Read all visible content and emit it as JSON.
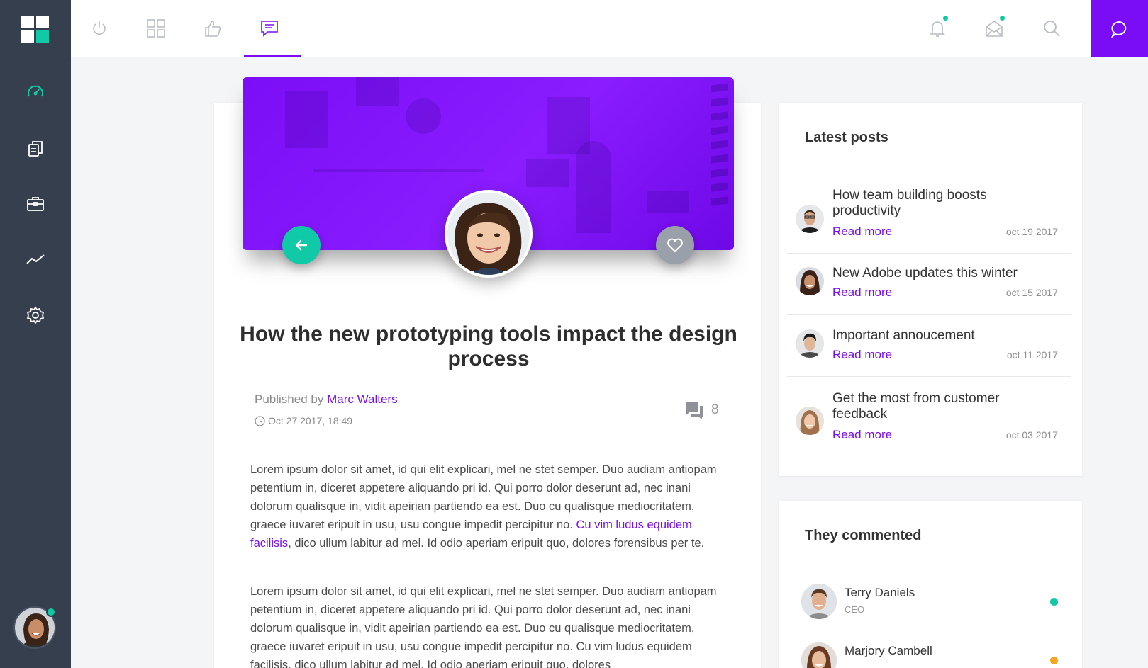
{
  "colors": {
    "accent": "#7a0df5",
    "teal": "#10c9a6",
    "sidebar_bg": "#363f4e",
    "online": "#10c9a6",
    "away": "#f5a623"
  },
  "sidebar": {
    "items": [
      {
        "icon": "speedometer-icon"
      },
      {
        "icon": "documents-icon"
      },
      {
        "icon": "briefcase-icon"
      },
      {
        "icon": "trend-chart-icon"
      },
      {
        "icon": "gear-icon"
      }
    ]
  },
  "topbar": {
    "tabs": [
      {
        "icon": "power-icon"
      },
      {
        "icon": "grid-icon"
      },
      {
        "icon": "thumbs-up-icon"
      },
      {
        "icon": "message-icon",
        "active": true
      }
    ],
    "actions": [
      {
        "icon": "bell-icon",
        "has_notification": true
      },
      {
        "icon": "mail-open-icon",
        "has_notification": true
      },
      {
        "icon": "search-icon"
      }
    ],
    "chat_icon": "chat-bubble-icon"
  },
  "article": {
    "title": "How the new prototyping tools impact the design process",
    "published_by_label": "Published by",
    "author": "Marc Walters",
    "date": "Oct 27 2017, 18:49",
    "comment_count": "8",
    "para1_before": "Lorem ipsum dolor sit amet, id qui elit explicari, mel ne stet semper. Duo audiam antiopam petentium in, diceret appetere aliquando pri id. Qui porro dolor deserunt ad, nec inani dolorum qualisque in, vidit apeirian partiendo ea est. Duo cu qualisque mediocritatem, graece iuvaret eripuit in usu, usu congue impedit percipitur no. ",
    "para1_link": "Cu vim ludus equidem facilisis",
    "para1_after": ", dico ullum labitur ad mel. Id odio aperiam eripuit quo, dolores forensibus per te.",
    "para2": "Lorem ipsum dolor sit amet, id qui elit explicari, mel ne stet semper. Duo audiam antiopam petentium in, diceret appetere aliquando pri id. Qui porro dolor deserunt ad, nec inani dolorum qualisque in, vidit apeirian partiendo ea est. Duo cu qualisque mediocritatem, graece iuvaret eripuit in usu, usu congue impedit percipitur no. Cu vim ludus equidem facilisis, dico ullum labitur ad mel. Id odio aperiam eripuit quo, dolores"
  },
  "latest_posts": {
    "title": "Latest posts",
    "read_more": "Read more",
    "items": [
      {
        "title": "How team building boosts productivity",
        "date": "oct 19 2017"
      },
      {
        "title": "New Adobe updates this winter",
        "date": "oct 15 2017"
      },
      {
        "title": "Important annoucement",
        "date": "oct 11 2017"
      },
      {
        "title": "Get the most from customer feedback",
        "date": "oct 03 2017"
      }
    ]
  },
  "commented": {
    "title": "They commented",
    "items": [
      {
        "name": "Terry Daniels",
        "role": "CEO",
        "status": "online"
      },
      {
        "name": "Marjory Cambell",
        "role": "",
        "status": "away"
      }
    ]
  }
}
